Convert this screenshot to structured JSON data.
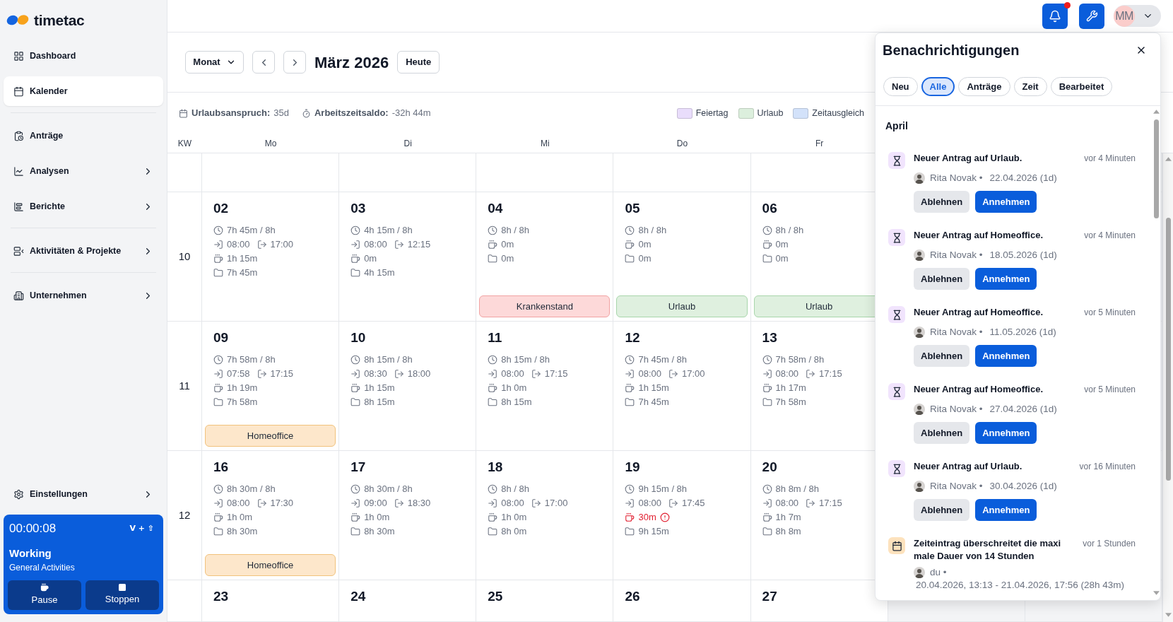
{
  "sidebar": {
    "logo": "timetac",
    "groups": [
      {
        "items": [
          {
            "label": "Dashboard",
            "selected": false,
            "expandable": false
          },
          {
            "label": "Kalender",
            "selected": true,
            "expandable": false
          }
        ]
      },
      {
        "items": [
          {
            "label": "Anträge",
            "selected": false,
            "expandable": false
          },
          {
            "label": "Analysen",
            "selected": false,
            "expandable": true
          },
          {
            "label": "Berichte",
            "selected": false,
            "expandable": true
          }
        ]
      },
      {
        "items": [
          {
            "label": "Aktivitäten & Projekte",
            "selected": false,
            "expandable": true
          }
        ]
      },
      {
        "items": [
          {
            "label": "Unternehmen",
            "selected": false,
            "expandable": true
          }
        ]
      }
    ],
    "footer_items": [
      {
        "label": "Einstellungen",
        "selected": false,
        "expandable": true
      }
    ],
    "timer": {
      "time": "00:00:08",
      "shortcut": "V + ⇧",
      "status": "Working",
      "activity": "General Activities",
      "actions": [
        "Pause",
        "Stoppen"
      ]
    }
  },
  "topbar": {
    "unread_notifications": true,
    "user_initials": "MM"
  },
  "calendar": {
    "view": "Monat",
    "title": "März 2026",
    "today_button": "Heute",
    "summary": [
      {
        "label": "Urlaubsanspruch:",
        "value": "35d"
      },
      {
        "label": "Arbeitszeitsaldo:",
        "value": "-32h 44m"
      }
    ],
    "legend": [
      {
        "label": "Feiertag",
        "color": "#e9ddfb"
      },
      {
        "label": "Urlaub",
        "color": "#dcefdd"
      },
      {
        "label": "Zeitausgleich",
        "color": "#d3e2fa"
      }
    ],
    "columns": [
      "KW",
      "Mo",
      "Di",
      "Mi",
      "Do",
      "Fr"
    ],
    "weeks": [
      {
        "kw": "10",
        "days": [
          {
            "date": "02",
            "worked": "7h 45m / 8h",
            "check_in": "08:00",
            "check_out": "17:00",
            "break": "1h 15m",
            "break_warning": false,
            "project": "7h 45m"
          },
          {
            "date": "03",
            "worked": "4h 15m / 8h",
            "check_in": "08:00",
            "check_out": "12:15",
            "break": "0m",
            "break_warning": false,
            "project": "4h 15m"
          },
          {
            "date": "04",
            "worked": "8h / 8h",
            "break": "0m",
            "break_warning": false,
            "project": "0m",
            "event": {
              "label": "Krankenstand",
              "kind": "sick"
            }
          },
          {
            "date": "05",
            "worked": "8h / 8h",
            "break": "0m",
            "break_warning": false,
            "project": "0m",
            "event": {
              "label": "Urlaub",
              "kind": "vacation"
            }
          },
          {
            "date": "06",
            "worked": "8h / 8h",
            "break": "0m",
            "break_warning": false,
            "project": "0m",
            "event": {
              "label": "Urlaub",
              "kind": "vacation"
            }
          }
        ]
      },
      {
        "kw": "11",
        "days": [
          {
            "date": "09",
            "worked": "7h 58m / 8h",
            "check_in": "07:58",
            "check_out": "17:15",
            "break": "1h 19m",
            "break_warning": false,
            "project": "7h 58m",
            "event": {
              "label": "Homeoffice",
              "kind": "homeoffice"
            }
          },
          {
            "date": "10",
            "worked": "8h 15m / 8h",
            "check_in": "08:30",
            "check_out": "18:00",
            "break": "1h 15m",
            "break_warning": false,
            "project": "8h 15m"
          },
          {
            "date": "11",
            "worked": "8h 15m / 8h",
            "check_in": "08:00",
            "check_out": "17:15",
            "break": "1h 0m",
            "break_warning": false,
            "project": "8h 15m"
          },
          {
            "date": "12",
            "worked": "7h 45m / 8h",
            "check_in": "08:00",
            "check_out": "17:00",
            "break": "1h 15m",
            "break_warning": false,
            "project": "7h 45m"
          },
          {
            "date": "13",
            "worked": "7h 58m / 8h",
            "check_in": "08:00",
            "check_out": "17:15",
            "break": "1h 17m",
            "break_warning": false,
            "project": "7h 58m"
          }
        ]
      },
      {
        "kw": "12",
        "days": [
          {
            "date": "16",
            "worked": "8h 30m / 8h",
            "check_in": "08:00",
            "check_out": "17:30",
            "break": "1h 0m",
            "break_warning": false,
            "project": "8h 30m",
            "event": {
              "label": "Homeoffice",
              "kind": "homeoffice"
            }
          },
          {
            "date": "17",
            "worked": "8h 30m / 8h",
            "check_in": "09:00",
            "check_out": "18:30",
            "break": "1h 0m",
            "break_warning": false,
            "project": "8h 30m"
          },
          {
            "date": "18",
            "worked": "8h / 8h",
            "check_in": "08:00",
            "check_out": "17:00",
            "break": "1h 0m",
            "break_warning": false,
            "project": "8h 0m"
          },
          {
            "date": "19",
            "worked": "9h 15m / 8h",
            "check_in": "08:00",
            "check_out": "17:45",
            "break": "30m",
            "break_warning": true,
            "project": "9h 15m"
          },
          {
            "date": "20",
            "worked": "8h 8m / 8h",
            "check_in": "08:00",
            "check_out": "17:15",
            "break": "1h 7m",
            "break_warning": false,
            "project": "8h 8m"
          }
        ]
      },
      {
        "days": [
          {
            "date": "23"
          },
          {
            "date": "24"
          },
          {
            "date": "25"
          },
          {
            "date": "26"
          },
          {
            "date": "27"
          }
        ]
      }
    ]
  },
  "notifications": {
    "title": "Benachrichtigungen",
    "filters": [
      {
        "label": "Neu",
        "selected": false
      },
      {
        "label": "Alle",
        "selected": true
      },
      {
        "label": "Anträge",
        "selected": false
      },
      {
        "label": "Zeit",
        "selected": false
      },
      {
        "label": "Bearbeitet",
        "selected": false
      }
    ],
    "groups": [
      {
        "label": "April",
        "items": [
          {
            "kind": "request",
            "title": "Neuer Antrag auf Urlaub.",
            "time": "vor 4 Minuten",
            "person": "Rita Novak •",
            "detail": "22.04.2026 (1d)",
            "actions": [
              {
                "label": "Ablehnen",
                "kind": "secondary"
              },
              {
                "label": "Annehmen",
                "kind": "primary"
              }
            ]
          },
          {
            "kind": "request",
            "title": "Neuer Antrag auf Homeoffice.",
            "time": "vor 4 Minuten",
            "person": "Rita Novak •",
            "detail": "18.05.2026 (1d)",
            "actions": [
              {
                "label": "Ablehnen",
                "kind": "secondary"
              },
              {
                "label": "Annehmen",
                "kind": "primary"
              }
            ]
          },
          {
            "kind": "request",
            "title": "Neuer Antrag auf Homeoffice.",
            "time": "vor 5 Minuten",
            "person": "Rita Novak •",
            "detail": "11.05.2026 (1d)",
            "actions": [
              {
                "label": "Ablehnen",
                "kind": "secondary"
              },
              {
                "label": "Annehmen",
                "kind": "primary"
              }
            ]
          },
          {
            "kind": "request",
            "title": "Neuer Antrag auf Homeoffice.",
            "time": "vor 5 Minuten",
            "person": "Rita Novak •",
            "detail": "27.04.2026 (1d)",
            "actions": [
              {
                "label": "Ablehnen",
                "kind": "secondary"
              },
              {
                "label": "Annehmen",
                "kind": "primary"
              }
            ]
          },
          {
            "kind": "request",
            "title": "Neuer Antrag auf Urlaub.",
            "time": "vor 16 Minuten",
            "person": "Rita Novak •",
            "detail": "30.04.2026 (1d)",
            "actions": [
              {
                "label": "Ablehnen",
                "kind": "secondary"
              },
              {
                "label": "Annehmen",
                "kind": "primary"
              }
            ]
          },
          {
            "kind": "time_entry",
            "title": "Zeiteintrag überschreitet die maximale Dauer von 14 Stunden",
            "time": "vor 1 Stunden",
            "person": "du •",
            "detail": "20.04.2026, 13:13 - 21.04.2026, 17:56 (28h 43m)"
          }
        ]
      }
    ]
  }
}
